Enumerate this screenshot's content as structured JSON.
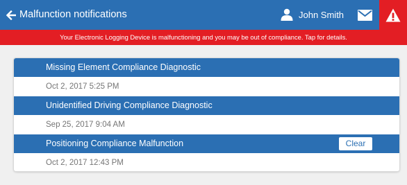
{
  "header": {
    "title": "Malfunction notifications",
    "user_name": "John Smith",
    "icons": {
      "back": "arrow-left-icon",
      "user": "user-icon",
      "mail": "mail-icon",
      "alert": "warning-icon"
    }
  },
  "banner": {
    "message": "Your Electronic Logging Device is malfunctioning and you may be out of compliance. Tap for details."
  },
  "notifications": [
    {
      "title": "Missing Element Compliance Diagnostic",
      "date": "Oct 2, 2017 5:25 PM"
    },
    {
      "title": "Unidentified Driving Compliance Diagnostic",
      "date": "Sep 25, 2017 9:04 AM"
    },
    {
      "title": "Positioning Compliance Malfunction",
      "date": "Oct 2, 2017 12:43 PM",
      "action_label": "Clear"
    }
  ],
  "colors": {
    "primary": "#2b6fb3",
    "alert": "#e31e24",
    "background": "#f0f0f0",
    "date_text": "#757575"
  }
}
